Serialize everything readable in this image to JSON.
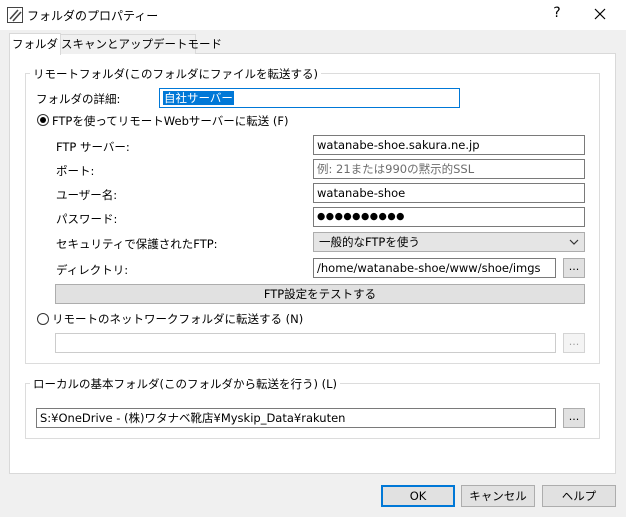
{
  "window": {
    "title": "フォルダのプロパティー",
    "help_label": "?",
    "close_icon": "close-icon"
  },
  "tabs": [
    {
      "label": "フォルダ",
      "active": true
    },
    {
      "label": "スキャンとアップデートモード",
      "active": false
    }
  ],
  "remote_group": {
    "title": "リモートフォルダ(このフォルダにファイルを転送する)",
    "details_label": "フォルダの詳細:",
    "details_value": "自社サーバー",
    "ftp_radio_label": "FTPを使ってリモートWebサーバーに転送 (F)",
    "ftp_radio_checked": true,
    "ftp_server_label": "FTP サーバー:",
    "ftp_server_value": "watanabe-shoe.sakura.ne.jp",
    "port_label": "ポート:",
    "port_placeholder": "例: 21または990の黙示的SSL",
    "username_label": "ユーザー名:",
    "username_value": "watanabe-shoe",
    "password_label": "パスワード:",
    "password_value": "●●●●●●●●●●",
    "secure_ftp_label": "セキュリティで保護されたFTP:",
    "secure_ftp_value": "一般的なFTPを使う",
    "directory_label": "ディレクトリ:",
    "directory_value": "/home/watanabe-shoe/www/shoe/imgs",
    "browse_label": "...",
    "test_button_label": "FTP設定をテストする",
    "network_radio_label": "リモートのネットワークフォルダに転送する (N)",
    "network_radio_checked": false,
    "network_path_value": "",
    "network_browse_label": "..."
  },
  "local_group": {
    "title": "ローカルの基本フォルダ(このフォルダから転送を行う) (L)",
    "path_value": "S:¥OneDrive - (株)ワタナベ靴店¥Myskip_Data¥rakuten",
    "browse_label": "..."
  },
  "buttons": {
    "ok": "OK",
    "cancel": "キャンセル",
    "help": "ヘルプ"
  },
  "colors": {
    "accent": "#0078d7",
    "window_bg": "#f0f0f0",
    "panel_bg": "#ffffff"
  }
}
